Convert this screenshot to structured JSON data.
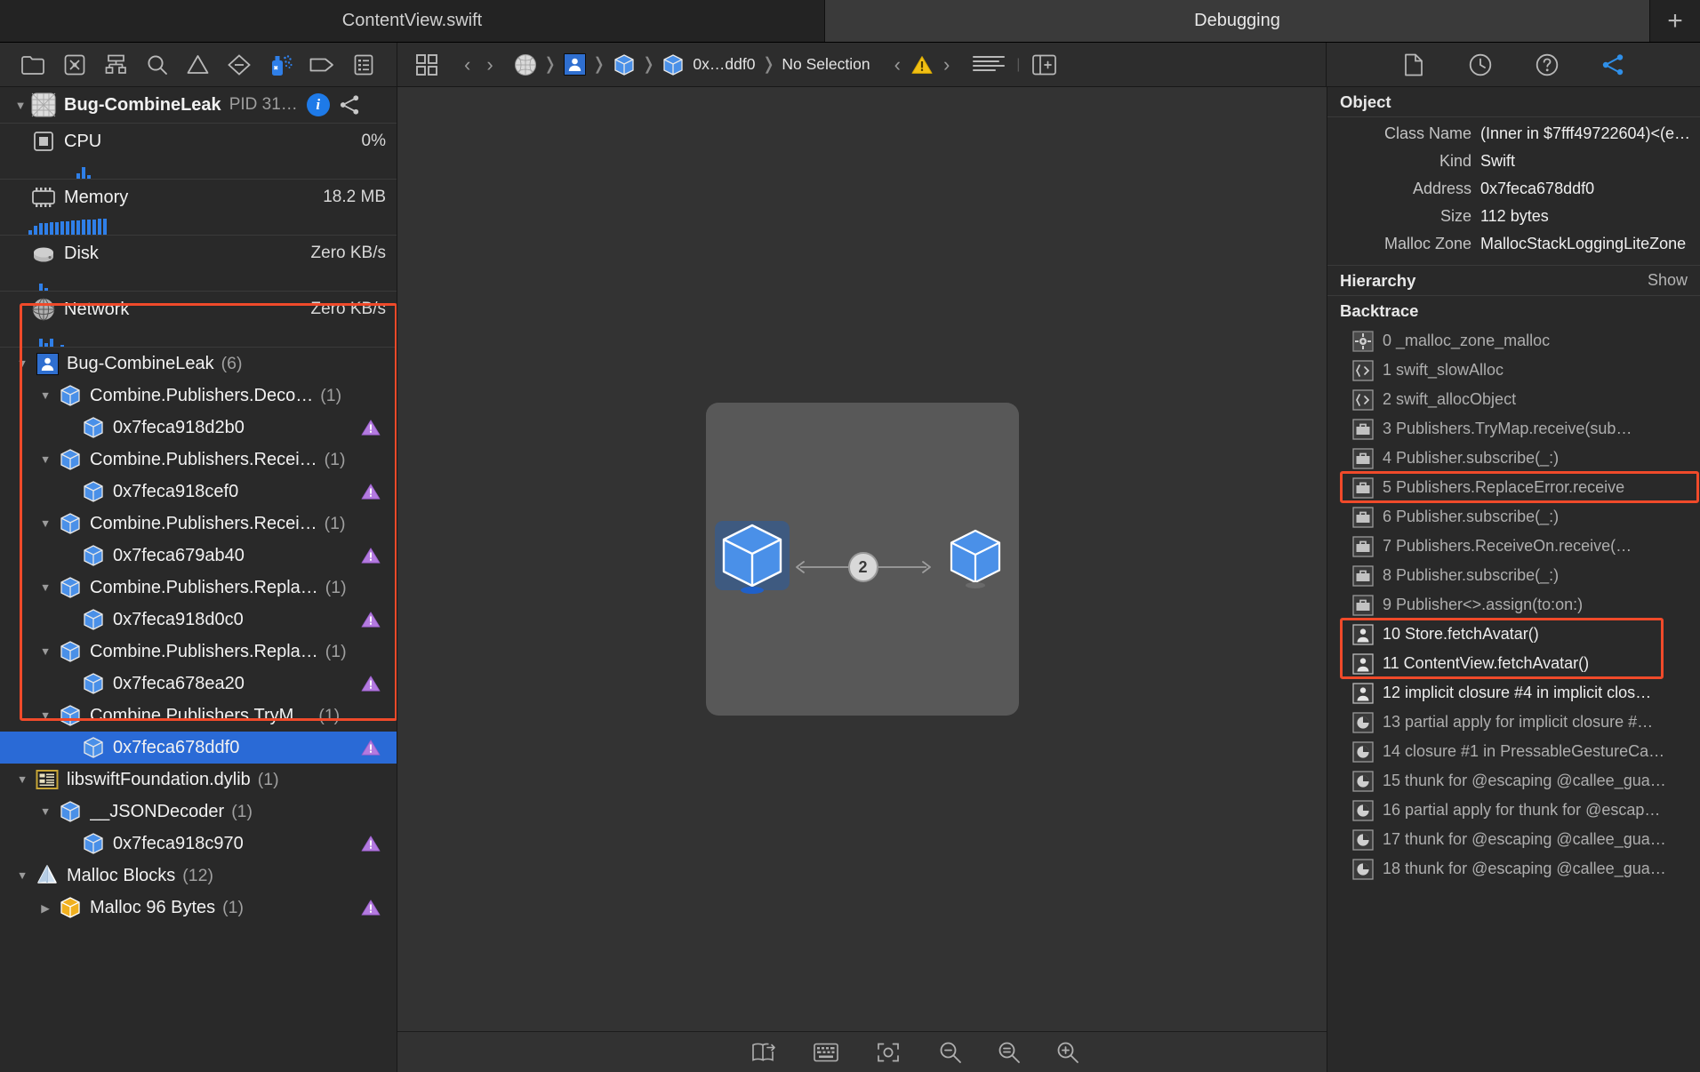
{
  "window": {
    "tabs": [
      {
        "label": "ContentView.swift",
        "active": false
      },
      {
        "label": "Debugging",
        "active": true
      }
    ],
    "add_tab_label": "+"
  },
  "navigator_toolbar": {
    "icons": [
      "folder-icon",
      "source-control-icon",
      "hierarchy-icon",
      "search-icon",
      "warning-icon",
      "test-diamond-icon",
      "debug-spray-icon",
      "tag-icon",
      "report-icon"
    ]
  },
  "jump_bar": {
    "grid_icon": "grid-icon",
    "back_label": "‹",
    "forward_label": "›",
    "path": [
      {
        "icon": "mesh-icon",
        "label": ""
      },
      {
        "icon": "person-icon",
        "label": ""
      },
      {
        "icon": "cube-icon",
        "label": ""
      },
      {
        "icon": "cube-icon",
        "label": "0x…ddf0"
      }
    ],
    "selection_label": "No Selection",
    "issue_prev": "‹",
    "issue_next": "›",
    "issue_icon": "warning-triangle-icon",
    "align_icon": "align-lines-icon",
    "panel_icon": "inspector-toggle-icon"
  },
  "inspector_toolbar": {
    "icons": [
      "file-inspector-icon",
      "history-inspector-icon",
      "help-inspector-icon",
      "object-inspector-icon"
    ],
    "active_index": 3
  },
  "gauges": {
    "process": {
      "name": "Bug-CombineLeak",
      "pid_label": "PID 31…",
      "info_badge": "i",
      "chain_icon": "process-link-icon"
    },
    "rows": [
      {
        "icon": "cpu-icon",
        "label": "CPU",
        "value": "0%",
        "bars": [
          0,
          0,
          0,
          0,
          0,
          0,
          0,
          0,
          0,
          6,
          13,
          4,
          0,
          0,
          0,
          0,
          0,
          0
        ]
      },
      {
        "icon": "memory-icon",
        "label": "Memory",
        "value": "18.2 MB",
        "bars": [
          5,
          10,
          13,
          13,
          14,
          14,
          15,
          15,
          16,
          16,
          17,
          17,
          17,
          18,
          18,
          0,
          0,
          0
        ]
      },
      {
        "icon": "disk-icon",
        "label": "Disk",
        "value": "Zero KB/s",
        "bars": [
          0,
          0,
          8,
          3,
          0,
          0,
          0,
          0,
          0,
          0,
          0,
          0,
          0,
          0,
          0,
          0,
          0,
          0
        ]
      },
      {
        "icon": "network-icon",
        "label": "Network",
        "value": "Zero KB/s",
        "bars": [
          0,
          0,
          9,
          4,
          9,
          0,
          2,
          0,
          0,
          0,
          0,
          0,
          0,
          0,
          0,
          0,
          0,
          0
        ]
      }
    ]
  },
  "memory_graph_tree": {
    "nodes": [
      {
        "level": 0,
        "disc": "open",
        "icon": "person-icon",
        "label": "Bug-CombineLeak",
        "count": "(6)",
        "warn": false,
        "selected": false
      },
      {
        "level": 1,
        "disc": "open",
        "icon": "cube-icon",
        "label": "Combine.Publishers.Deco…",
        "count": "(1)",
        "warn": false,
        "selected": false
      },
      {
        "level": 2,
        "disc": "none",
        "icon": "cube-icon",
        "label": "0x7feca918d2b0",
        "count": "",
        "warn": true,
        "selected": false
      },
      {
        "level": 1,
        "disc": "open",
        "icon": "cube-icon",
        "label": "Combine.Publishers.Recei…",
        "count": "(1)",
        "warn": false,
        "selected": false
      },
      {
        "level": 2,
        "disc": "none",
        "icon": "cube-icon",
        "label": "0x7feca918cef0",
        "count": "",
        "warn": true,
        "selected": false
      },
      {
        "level": 1,
        "disc": "open",
        "icon": "cube-icon",
        "label": "Combine.Publishers.Recei…",
        "count": "(1)",
        "warn": false,
        "selected": false
      },
      {
        "level": 2,
        "disc": "none",
        "icon": "cube-icon",
        "label": "0x7feca679ab40",
        "count": "",
        "warn": true,
        "selected": false
      },
      {
        "level": 1,
        "disc": "open",
        "icon": "cube-icon",
        "label": "Combine.Publishers.Repla…",
        "count": "(1)",
        "warn": false,
        "selected": false
      },
      {
        "level": 2,
        "disc": "none",
        "icon": "cube-icon",
        "label": "0x7feca918d0c0",
        "count": "",
        "warn": true,
        "selected": false
      },
      {
        "level": 1,
        "disc": "open",
        "icon": "cube-icon",
        "label": "Combine.Publishers.Repla…",
        "count": "(1)",
        "warn": false,
        "selected": false
      },
      {
        "level": 2,
        "disc": "none",
        "icon": "cube-icon",
        "label": "0x7feca678ea20",
        "count": "",
        "warn": true,
        "selected": false
      },
      {
        "level": 1,
        "disc": "open",
        "icon": "cube-icon",
        "label": "Combine.Publishers.TryM…",
        "count": "(1)",
        "warn": false,
        "selected": false
      },
      {
        "level": 2,
        "disc": "none",
        "icon": "cube-icon",
        "label": "0x7feca678ddf0",
        "count": "",
        "warn": true,
        "selected": true
      },
      {
        "level": 0,
        "disc": "open",
        "icon": "dylib-icon",
        "label": "libswiftFoundation.dylib",
        "count": "(1)",
        "warn": false,
        "selected": false
      },
      {
        "level": 1,
        "disc": "open",
        "icon": "cube-icon",
        "label": "__JSONDecoder",
        "count": "(1)",
        "warn": false,
        "selected": false
      },
      {
        "level": 2,
        "disc": "none",
        "icon": "cube-icon",
        "label": "0x7feca918c970",
        "count": "",
        "warn": true,
        "selected": false
      },
      {
        "level": 0,
        "disc": "open",
        "icon": "malloc-icon",
        "label": "Malloc Blocks",
        "count": "(12)",
        "warn": false,
        "selected": false
      },
      {
        "level": 1,
        "disc": "closed",
        "icon": "cube-gold-icon",
        "label": "Malloc 96 Bytes",
        "count": "(1)",
        "warn": true,
        "selected": false
      }
    ]
  },
  "graph_canvas": {
    "edge_count_label": "2",
    "selected_node": "cube-node-selected",
    "other_node": "cube-node"
  },
  "canvas_toolbar": {
    "icons": [
      "open-in-new-icon",
      "keyboard-icon",
      "focus-icon",
      "zoom-out-icon",
      "zoom-fit-icon",
      "zoom-in-icon"
    ]
  },
  "inspector": {
    "object_section": {
      "title": "Object",
      "fields": [
        {
          "key": "Class Name",
          "value": "(Inner in $7fff49722604)<(ex…"
        },
        {
          "key": "Kind",
          "value": "Swift"
        },
        {
          "key": "Address",
          "value": "0x7feca678ddf0"
        },
        {
          "key": "Size",
          "value": "112 bytes"
        },
        {
          "key": "Malloc Zone",
          "value": "MallocStackLoggingLiteZone"
        }
      ]
    },
    "hierarchy_section": {
      "title": "Hierarchy",
      "action": "Show"
    },
    "backtrace_section": {
      "title": "Backtrace",
      "frames": [
        {
          "index": "0",
          "name": "_malloc_zone_malloc",
          "icon": "gear-frame-icon",
          "user": false,
          "highlight": false
        },
        {
          "index": "1",
          "name": "swift_slowAlloc",
          "icon": "runtime-frame-icon",
          "user": false,
          "highlight": false
        },
        {
          "index": "2",
          "name": "swift_allocObject",
          "icon": "runtime-frame-icon",
          "user": false,
          "highlight": false
        },
        {
          "index": "3",
          "name": "Publishers.TryMap.receive<A>(sub…",
          "icon": "framework-icon",
          "user": false,
          "highlight": false
        },
        {
          "index": "4",
          "name": "Publisher.subscribe<A>(_:)",
          "icon": "framework-icon",
          "user": false,
          "highlight": false
        },
        {
          "index": "5",
          "name": "Publishers.ReplaceError.receive<A…",
          "icon": "framework-icon",
          "user": false,
          "highlight": true
        },
        {
          "index": "6",
          "name": "Publisher.subscribe<A>(_:)",
          "icon": "framework-icon",
          "user": false,
          "highlight": false
        },
        {
          "index": "7",
          "name": "Publishers.ReceiveOn.receive<A>(…",
          "icon": "framework-icon",
          "user": false,
          "highlight": false
        },
        {
          "index": "8",
          "name": "Publisher.subscribe<A>(_:)",
          "icon": "framework-icon",
          "user": false,
          "highlight": false
        },
        {
          "index": "9",
          "name": "Publisher<>.assign<A>(to:on:)",
          "icon": "framework-icon",
          "user": false,
          "highlight": false
        },
        {
          "index": "10",
          "name": "Store.fetchAvatar()",
          "icon": "person-frame-icon",
          "user": true,
          "highlight": true
        },
        {
          "index": "11",
          "name": "ContentView.fetchAvatar()",
          "icon": "person-frame-icon",
          "user": true,
          "highlight": true
        },
        {
          "index": "12",
          "name": "implicit closure #4 in implicit clos…",
          "icon": "person-frame-icon",
          "user": true,
          "highlight": false
        },
        {
          "index": "13",
          "name": "partial apply for implicit closure #…",
          "icon": "pie-frame-icon",
          "user": false,
          "highlight": false
        },
        {
          "index": "14",
          "name": "closure #1 in PressableGestureCa…",
          "icon": "pie-frame-icon",
          "user": false,
          "highlight": false
        },
        {
          "index": "15",
          "name": "thunk for @escaping @callee_gua…",
          "icon": "pie-frame-icon",
          "user": false,
          "highlight": false
        },
        {
          "index": "16",
          "name": "partial apply for thunk for @escap…",
          "icon": "pie-frame-icon",
          "user": false,
          "highlight": false
        },
        {
          "index": "17",
          "name": "thunk for @escaping @callee_gua…",
          "icon": "pie-frame-icon",
          "user": false,
          "highlight": false
        },
        {
          "index": "18",
          "name": "thunk for @escaping @callee_gua…",
          "icon": "pie-frame-icon",
          "user": false,
          "highlight": false
        }
      ]
    }
  },
  "colors": {
    "accent_blue": "#2a6ad6",
    "highlight_red": "#f04a2a",
    "cube_blue": "#4a90e8",
    "warn_purple": "#b47ae0"
  }
}
